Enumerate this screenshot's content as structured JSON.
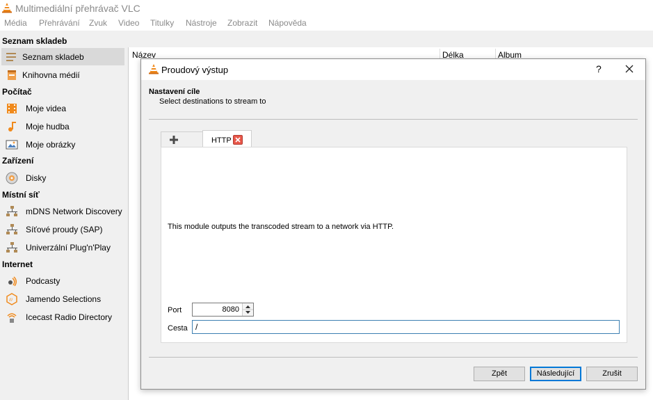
{
  "window": {
    "title": "Multimediální přehrávač VLC"
  },
  "menu": [
    "Média",
    "Přehrávání",
    "Zvuk",
    "Video",
    "Titulky",
    "Nástroje",
    "Zobrazit",
    "Nápověda"
  ],
  "sidebar": {
    "sections": [
      "Seznam skladeb",
      "Počítač",
      "Zařízení",
      "Místní síť",
      "Internet"
    ],
    "items": [
      {
        "label": "Seznam skladeb",
        "icon": "playlist-icon"
      },
      {
        "label": "Knihovna médií",
        "icon": "media-library-icon"
      },
      {
        "label": "Moje videa",
        "icon": "film-icon"
      },
      {
        "label": "Moje hudba",
        "icon": "music-note-icon"
      },
      {
        "label": "Moje obrázky",
        "icon": "picture-icon"
      },
      {
        "label": "Disky",
        "icon": "disc-icon"
      },
      {
        "label": "mDNS Network Discovery",
        "icon": "network-icon"
      },
      {
        "label": "Síťové proudy (SAP)",
        "icon": "network-icon"
      },
      {
        "label": "Univerzální Plug'n'Play",
        "icon": "network-icon"
      },
      {
        "label": "Podcasty",
        "icon": "podcast-icon"
      },
      {
        "label": "Jamendo Selections",
        "icon": "jamendo-icon"
      },
      {
        "label": "Icecast Radio Directory",
        "icon": "icecast-icon"
      }
    ]
  },
  "playlist": {
    "columns": [
      "Název",
      "Délka",
      "Album"
    ]
  },
  "dialog": {
    "title": "Proudový výstup",
    "help": "?",
    "header_title": "Nastavení cíle",
    "header_subtitle": "Select destinations to stream to",
    "tab_label": "HTTP",
    "description": "This module outputs the transcoded stream to a network via HTTP.",
    "port_label": "Port",
    "port_value": "8080",
    "path_label": "Cesta",
    "path_value": "/",
    "buttons": {
      "back": "Zpět",
      "next": "Následující",
      "cancel": "Zrušit"
    }
  },
  "colors": {
    "accent": "#0078d7",
    "vlc_orange": "#f08a1c",
    "selection": "#d9d9d9"
  }
}
